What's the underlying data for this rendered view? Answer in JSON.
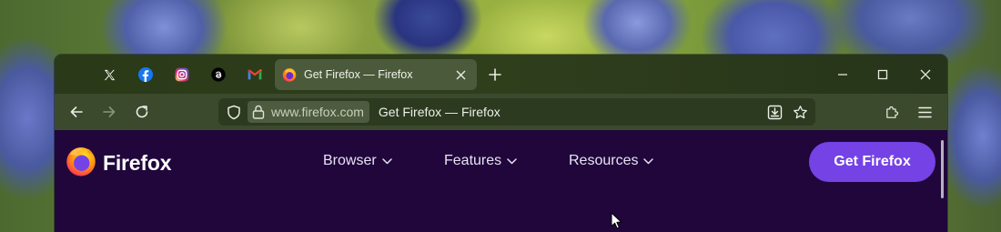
{
  "browser": {
    "pinned_tabs": [
      {
        "name": "x-icon"
      },
      {
        "name": "facebook-icon"
      },
      {
        "name": "instagram-icon"
      },
      {
        "name": "threads-icon"
      },
      {
        "name": "gmail-icon"
      }
    ],
    "active_tab": {
      "title": "Get Firefox — Firefox",
      "icon": "firefox-icon"
    },
    "url": {
      "domain": "www.firefox.com",
      "page_title": "Get Firefox — Firefox"
    },
    "colors": {
      "tabstrip": "#2f3f1c",
      "toolbar": "#3b4a2c",
      "active_tab": "#4a5a3a"
    }
  },
  "page": {
    "logo_text": "Firefox",
    "nav": [
      {
        "label": "Browser"
      },
      {
        "label": "Features"
      },
      {
        "label": "Resources"
      }
    ],
    "cta_label": "Get Firefox",
    "colors": {
      "background": "#20063b",
      "cta": "#7542e5"
    }
  }
}
